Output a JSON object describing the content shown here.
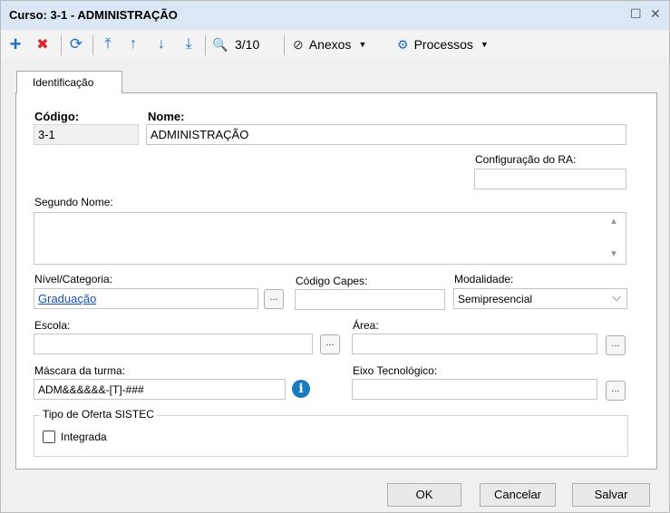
{
  "window": {
    "title": "Curso: 3-1 - ADMINISTRAÇÃO",
    "restore_glyph": "☐",
    "close_glyph": "✕"
  },
  "toolbar": {
    "add_glyph": "+",
    "delete_glyph": "✖",
    "refresh_glyph": "⟳",
    "first_glyph": "⤒",
    "prev_glyph": "↑",
    "next_glyph": "↓",
    "last_glyph": "⤓",
    "search_glyph": "🔍",
    "record_counter": "3/10",
    "attachments_label": "Anexos",
    "processes_label": "Processos",
    "dropdown_glyph": "▼"
  },
  "tab": {
    "label": "Identificação"
  },
  "form": {
    "codigo_label": "Código:",
    "codigo_value": "3-1",
    "nome_label": "Nome:",
    "nome_value": "ADMINISTRAÇÃO",
    "config_ra_label": "Configuração do RA:",
    "config_ra_value": "",
    "segundo_nome_label": "Segundo Nome:",
    "segundo_nome_value": "",
    "scroll_up_glyph": "▲",
    "scroll_down_glyph": "▼",
    "nivel_label": "Nível/Categoria:",
    "nivel_value": "Graduação",
    "codigo_capes_label": "Código Capes:",
    "codigo_capes_value": "",
    "modalidade_label": "Modalidade:",
    "modalidade_value": "Semipresencial",
    "escola_label": "Escola:",
    "escola_value": "",
    "area_label": "Área:",
    "area_value": "",
    "mascara_label": "Máscara da turma:",
    "mascara_value": "ADM&&&&&&-[T]-###",
    "eixo_label": "Eixo Tecnológico:",
    "eixo_value": "",
    "lookup_glyph": "...",
    "info_glyph": "i",
    "chevron_glyph": "⌵",
    "oferta_group_label": "Tipo de Oferta SISTEC",
    "integrada_label": "Integrada",
    "integrada_checked": false
  },
  "buttons": {
    "ok": "OK",
    "cancel": "Cancelar",
    "save": "Salvar"
  },
  "colors": {
    "titlebar": "#dce7f5",
    "accent": "#1e6fc3",
    "delete": "#d9232f",
    "info": "#1b7bbf"
  }
}
